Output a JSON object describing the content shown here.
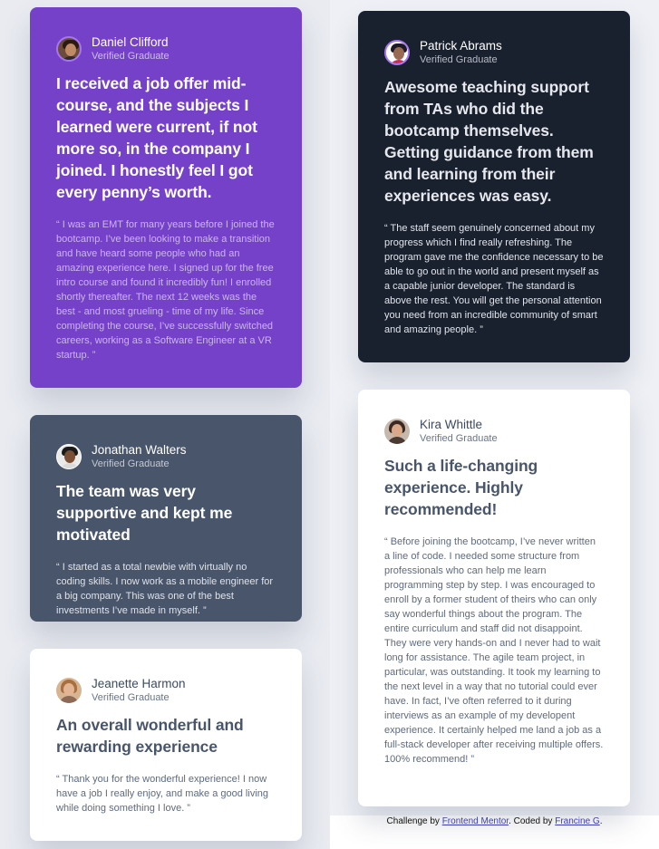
{
  "colors": {
    "violet": "#7541c8",
    "dark_blue": "#19212e",
    "grayish_blue": "#48556a",
    "white": "#ffffff",
    "light_bg": "#e9ecf2",
    "avatar_ring": "#a775f1"
  },
  "testimonials": [
    {
      "name": "Daniel Clifford",
      "role": "Verified Graduate",
      "avatar_icon": "daniel-avatar",
      "headline": "I received a job offer mid-course, and the subjects I learned were current, if not more so, in the company I joined. I honestly feel I got every penny’s worth.",
      "quote": "“ I was an EMT for many years before I joined the bootcamp. I’ve been looking to make a transition and have heard some people who had an amazing experience here. I signed up for the free intro course and found it incredibly fun! I enrolled shortly thereafter. The next 12 weeks was the best - and most grueling - time of my life. Since completing the course, I’ve successfully switched careers, working as a Software Engineer at a VR startup. ”"
    },
    {
      "name": "Patrick Abrams",
      "role": "Verified Graduate",
      "avatar_icon": "patrick-avatar",
      "headline": "Awesome teaching support from TAs who did the bootcamp themselves. Getting guidance from them and learning from their experiences was easy.",
      "quote": "“ The staff seem genuinely concerned about my progress which I find really refreshing. The program gave me the confidence necessary to be able to go out in the world and present myself as a capable junior developer. The standard is above the rest. You will get the personal attention you need from an incredible community of smart and amazing people. ”"
    },
    {
      "name": "Jonathan Walters",
      "role": "Verified Graduate",
      "avatar_icon": "jonathan-avatar",
      "headline": "The team was very supportive and kept me motivated",
      "quote": "“ I started as a total newbie with virtually no coding skills. I now work as a mobile engineer for a big company. This was one of the best investments I’ve made in myself. ”"
    },
    {
      "name": "Kira Whittle",
      "role": "Verified Graduate",
      "avatar_icon": "kira-avatar",
      "headline": "Such a life-changing experience. Highly recommended!",
      "quote": "“ Before joining the bootcamp, I’ve never written a line of code. I needed some structure from professionals who can help me learn programming step by step. I was encouraged to enroll by a former student of theirs who can only say wonderful things about the program. The entire curriculum and staff did not disappoint. They were very hands-on and I never had to wait long for assistance. The agile team project, in particular, was outstanding. It took my learning to the next level in a way that no tutorial could ever have. In fact, I’ve often referred to it during interviews as an example of my developent experience. It certainly helped me land a job as a full-stack developer after receiving multiple offers. 100% recommend! ”"
    },
    {
      "name": "Jeanette Harmon",
      "role": "Verified Graduate",
      "avatar_icon": "jeanette-avatar",
      "headline": "An overall wonderful and rewarding experience",
      "quote": "“ Thank you for the wonderful experience! I now have a job I really enjoy, and make a good living while doing something I love. ”"
    }
  ],
  "footer": {
    "prefix": "Challenge by ",
    "link1": "Frontend Mentor",
    "middle": ". Coded by ",
    "link2": "Francine G",
    "suffix": "."
  }
}
